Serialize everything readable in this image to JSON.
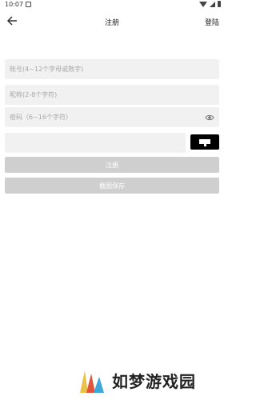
{
  "status": {
    "time": "10:07"
  },
  "app_bar": {
    "title": "注册",
    "login_label": "登陆"
  },
  "form": {
    "account_placeholder": "账号(4~12个字母或数字)",
    "nickname_placeholder": "昵称(2-8个字符)",
    "password_placeholder": "密码（6~16个字符）",
    "captcha_value": ""
  },
  "buttons": {
    "register": "注册",
    "save_screenshot": "截图保存"
  },
  "watermark": {
    "text": "如梦游戏园"
  },
  "colors": {
    "field_bg": "#f1f1f1",
    "button_bg": "#cfcfcf",
    "captcha_bg": "#000000"
  }
}
